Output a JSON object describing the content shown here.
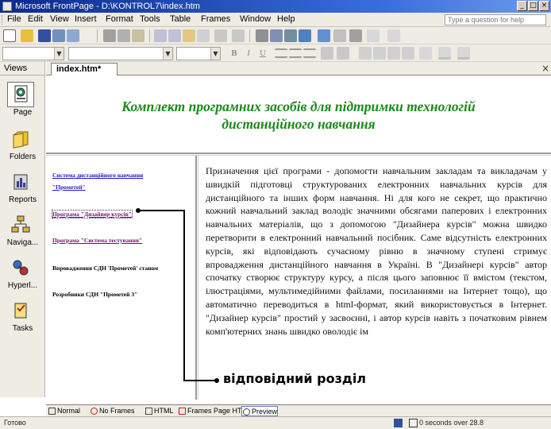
{
  "window": {
    "title": "Microsoft FrontPage - D:\\KONTROL7\\index.htm",
    "controls": [
      "_",
      "□",
      "×"
    ]
  },
  "menubar": {
    "items": [
      "File",
      "Edit",
      "View",
      "Insert",
      "Format",
      "Tools",
      "Table",
      "Frames",
      "Window",
      "Help"
    ],
    "help_box_placeholder": "Type a question for help"
  },
  "toolbar_format": {
    "bold": "B",
    "italic": "I",
    "underline": "U"
  },
  "views": {
    "title": "Views",
    "items": [
      {
        "label": "Page",
        "icon": "page-view-icon",
        "selected": true
      },
      {
        "label": "Folders",
        "icon": "folders-view-icon"
      },
      {
        "label": "Reports",
        "icon": "reports-view-icon"
      },
      {
        "label": "Naviga...",
        "icon": "navigation-view-icon"
      },
      {
        "label": "Hyperl...",
        "icon": "hyperlinks-view-icon"
      },
      {
        "label": "Tasks",
        "icon": "tasks-view-icon"
      }
    ]
  },
  "document_tab": {
    "label": "index.htm*"
  },
  "page": {
    "title_line1": "Комплект програмних засобів для підтримки технологій",
    "title_line2": "дистанційного навчання",
    "nav_links": [
      {
        "text": "Система дистанційного навчання",
        "style": "blue"
      },
      {
        "text": "\"Прометей\"",
        "style": "blue"
      },
      {
        "text": "Програма \"Дизайнер курсів\"",
        "style": "purple"
      },
      {
        "text": "Програма \"Система тестування\"",
        "style": "purple"
      },
      {
        "text": "Впровадження СДН 'Прометей' станом",
        "style": "black"
      },
      {
        "text": "Розробники СДН \"Прометей 3\"",
        "style": "black"
      }
    ],
    "body_text": "Призначення цієї програми - допомогти навчальним закладам та викладачам у швидкій підготовці структурованих електронних навчальних курсів для дистанційного та інших форм навчання. Ні для кого не секрет, що практично кожний навчальний заклад володіє значними обсягами паперових і електронних навчальних матеріалів, що з допомогою \"Дизайнера курсів\" можна швидко перетворити в електронний навчальний посібник. Саме відсутність електронних курсів, які відповідають сучасному рівню в значному ступені стримує впровадження дистанційного навчання в Україні. В \"Дизайнері курсів\" автор спочатку створює структуру курсу, а після цього заповнює її вмістом (текстом, ілюстраціями, мультимедійними файлами, посиланнями на Інтернет тощо), що автоматично переводиться в html-формат, який використовується в Інтернет. \"Дизайнер курсів\" простий у засвоєнні, і автор курсів навіть з початковим рівнем комп'ютерних знань швидко оволодіє ім",
    "annotation_label": "відповідний розділ"
  },
  "view_tabs": [
    {
      "label": "Normal"
    },
    {
      "label": "No Frames"
    },
    {
      "label": "HTML"
    },
    {
      "label": "Frames Page HTML"
    },
    {
      "label": "Preview",
      "active": true
    }
  ],
  "statusbar": {
    "text": "Готово",
    "timing": "0 seconds over 28.8"
  },
  "colors": {
    "title_green": "#1a8a1a",
    "link_blue": "#1a1ad8",
    "link_purple": "#7a0a7a",
    "titlebar_blue": "#0a2a8c"
  }
}
